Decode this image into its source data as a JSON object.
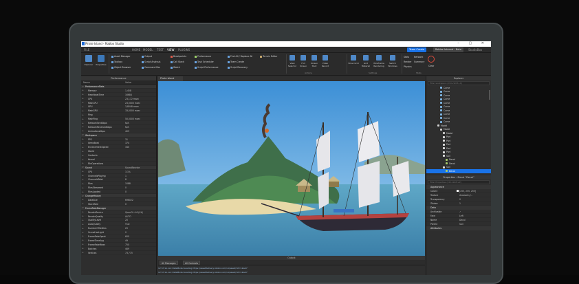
{
  "window": {
    "title": "Pirate Island - Roblox Studio"
  },
  "menu": {
    "tabs": [
      "FILE",
      "HOME",
      "MODEL",
      "TEST",
      "VIEW",
      "PLUGINS"
    ],
    "active_tab": "VIEW",
    "share_button": "Team Create",
    "beta_label": "Roblox Internal - Beta",
    "user": "StudioBox"
  },
  "ribbon": {
    "explorer": "Explorer",
    "properties": "Properties",
    "show_col1": [
      "Asset Manager",
      "Toolbox",
      "Object Browser"
    ],
    "show_col2": [
      "Output",
      "Script Analysis",
      "Command Bar"
    ],
    "show_col3": [
      "Breakpoints",
      "Call Stack",
      "Watch"
    ],
    "show_col4": [
      "Performance",
      "Task Scheduler",
      "Script Performance"
    ],
    "show_col5": [
      "Find All / Replace All",
      "Team Create",
      "Script Recovery"
    ],
    "show_col6": [
      "Terrain Editor"
    ],
    "actions_buttons": [
      "View Selector",
      "Full Screen",
      "Screen Shot",
      "Video Record"
    ],
    "settings_buttons": [
      "Show Grid",
      "Grid Material",
      "Wireframe Rendering",
      "Switch Windows"
    ],
    "stats": [
      "Stats",
      "Render",
      "Network",
      "Summary",
      "Physics"
    ],
    "clear_label": "Clear",
    "group_actions": "Actions",
    "group_settings": "Settings",
    "group_stats": "Stats"
  },
  "left_panel": {
    "title": "Performance",
    "col_name": "Name",
    "col_value": "Value",
    "rows": [
      {
        "name": "PerformanceStats",
        "value": "",
        "section": true
      },
      {
        "name": "Memory",
        "value": "1,458",
        "section": false
      },
      {
        "name": "HeartbeatTime",
        "value": "16684",
        "section": false
      },
      {
        "name": "CPU",
        "value": "23,172 msec",
        "section": false
      },
      {
        "name": "MainCPU",
        "value": "23,0000 msec",
        "section": false
      },
      {
        "name": "GPU",
        "value": "3,8048 msec",
        "section": false
      },
      {
        "name": "MainGPU",
        "value": "33,0000 msec",
        "section": false
      },
      {
        "name": "Ping",
        "value": "",
        "section": false
      },
      {
        "name": "MainPing",
        "value": "50,0000 msec",
        "section": false
      },
      {
        "name": "NetworkSentKbps",
        "value": "N/A",
        "section": false
      },
      {
        "name": "NetworkReceivedKbps",
        "value": "N/A",
        "section": false
      },
      {
        "name": "AnimationsKbps",
        "value": "409",
        "section": false
      },
      {
        "name": "Workspace",
        "value": "",
        "section": true
      },
      {
        "name": "FPS",
        "value": "31",
        "section": false
      },
      {
        "name": "ItemsBeat",
        "value": "374",
        "section": false
      },
      {
        "name": "EnvironmentSpeed",
        "value": "340",
        "section": false
      },
      {
        "name": "World",
        "value": "",
        "section": false
      },
      {
        "name": "Contacts",
        "value": "",
        "section": false
      },
      {
        "name": "Kernel",
        "value": "",
        "section": false
      },
      {
        "name": "FileOperations",
        "value": "",
        "section": false
      },
      {
        "name": "Sound",
        "value": "SoundService",
        "section": true
      },
      {
        "name": "CPU",
        "value": "3.1%",
        "section": false
      },
      {
        "name": "ChannelsPlaying",
        "value": "1",
        "section": false
      },
      {
        "name": "ChannelsTotal",
        "value": "8",
        "section": false
      },
      {
        "name": "Files",
        "value": "1088",
        "section": false
      },
      {
        "name": "FilesStreamed",
        "value": "0",
        "section": false
      },
      {
        "name": "FilesLoaded",
        "value": "0",
        "section": false
      },
      {
        "name": "ChangeHistory",
        "value": "",
        "section": true
      },
      {
        "name": "DataSize",
        "value": "696022",
        "section": false
      },
      {
        "name": "StackSize",
        "value": "0",
        "section": false
      },
      {
        "name": "FrameRateManager",
        "value": "",
        "section": true
      },
      {
        "name": "RenderDevice",
        "value": "OpenGL 4.6 (4X)",
        "section": false
      },
      {
        "name": "RenderQuality",
        "value": "AUTO",
        "section": false
      },
      {
        "name": "QualityLevel",
        "value": "20",
        "section": false
      },
      {
        "name": "AutoQuality",
        "value": "True",
        "section": false
      },
      {
        "name": "NumberOfSettles",
        "value": "25",
        "section": false
      },
      {
        "name": "SceneHasLight",
        "value": "0",
        "section": false
      },
      {
        "name": "FrameRateSpent",
        "value": "600",
        "section": false
      },
      {
        "name": "FrameTimeAvg",
        "value": "49",
        "section": false
      },
      {
        "name": "FrameRateMean",
        "value": "750",
        "section": false
      },
      {
        "name": "Batches",
        "value": "469",
        "section": false
      },
      {
        "name": "Vertices",
        "value": "73,775",
        "section": false
      }
    ]
  },
  "viewport": {
    "tab_label": "Pirate Island"
  },
  "output": {
    "title": "Output",
    "filter_messages": "All Messages",
    "filter_contexts": "All Contexts",
    "lines": [
      "12:57:xx.xxx  DataModel Loading https://assetdelivery.roblox.com/v1/asset/?id=1kw47",
      "12:57:xx.xxx  DataModel Loading https://assetdelivery.roblox.com/v1/asset/?id=1kw47"
    ]
  },
  "explorer": {
    "title": "Explorer",
    "filter_placeholder": "Filter workspace (Ctrl+Shift+X)",
    "items": [
      {
        "label": "Curve",
        "indent": 5,
        "icon": "#7fb8e6",
        "selected": false
      },
      {
        "label": "Curve",
        "indent": 5,
        "icon": "#7fb8e6",
        "selected": false
      },
      {
        "label": "Curve",
        "indent": 5,
        "icon": "#7fb8e6",
        "selected": false
      },
      {
        "label": "Curve",
        "indent": 5,
        "icon": "#7fb8e6",
        "selected": false
      },
      {
        "label": "Curve",
        "indent": 5,
        "icon": "#7fb8e6",
        "selected": false
      },
      {
        "label": "Curve",
        "indent": 5,
        "icon": "#7fb8e6",
        "selected": false
      },
      {
        "label": "Curve",
        "indent": 5,
        "icon": "#7fb8e6",
        "selected": false
      },
      {
        "label": "Curve",
        "indent": 5,
        "icon": "#7fb8e6",
        "selected": false
      },
      {
        "label": "Curve",
        "indent": 5,
        "icon": "#7fb8e6",
        "selected": false
      },
      {
        "label": "Curve",
        "indent": 5,
        "icon": "#7fb8e6",
        "selected": false
      },
      {
        "label": "Model",
        "indent": 4,
        "icon": "#d0d0d0",
        "selected": false
      },
      {
        "label": "Model",
        "indent": 5,
        "icon": "#d0d0d0",
        "selected": false
      },
      {
        "label": "Model",
        "indent": 6,
        "icon": "#d0d0d0",
        "selected": false
      },
      {
        "label": "Part",
        "indent": 6,
        "icon": "#e0e0e0",
        "selected": false
      },
      {
        "label": "Part",
        "indent": 6,
        "icon": "#e0e0e0",
        "selected": false
      },
      {
        "label": "Part",
        "indent": 6,
        "icon": "#e0e0e0",
        "selected": false
      },
      {
        "label": "Part",
        "indent": 6,
        "icon": "#e0e0e0",
        "selected": false
      },
      {
        "label": "Part",
        "indent": 6,
        "icon": "#e0e0e0",
        "selected": false
      },
      {
        "label": "Sail",
        "indent": 6,
        "icon": "#e0e0e0",
        "selected": false
      },
      {
        "label": "Decal",
        "indent": 7,
        "icon": "#a6c96a",
        "selected": false
      },
      {
        "label": "Decal",
        "indent": 7,
        "icon": "#a6c96a",
        "selected": false
      },
      {
        "label": "Sail",
        "indent": 6,
        "icon": "#e0e0e0",
        "selected": false
      },
      {
        "label": "Decal",
        "indent": 7,
        "icon": "#a6c96a",
        "selected": true
      }
    ]
  },
  "properties": {
    "title": "Properties - Decal \"Decal\"",
    "filter_placeholder": "Filter Properties (Ctrl+Shift+P)",
    "appearance": "Appearance",
    "appearance_rows": [
      {
        "name": "Color3",
        "value": "[255, 255, 255]",
        "swatch": "#ffffff"
      },
      {
        "name": "Texture",
        "value": "rbxasset://...",
        "swatch": ""
      },
      {
        "name": "Transparency",
        "value": "0",
        "swatch": ""
      },
      {
        "name": "ZIndex",
        "value": "1",
        "swatch": ""
      }
    ],
    "data": "Data",
    "data_rows": [
      {
        "name": "Archivable",
        "value": "✓",
        "swatch": ""
      },
      {
        "name": "Face",
        "value": "Left",
        "swatch": ""
      },
      {
        "name": "Name",
        "value": "Decal",
        "swatch": ""
      },
      {
        "name": "Parent",
        "value": "Sail",
        "swatch": ""
      }
    ],
    "attributes": "Attributes"
  },
  "colors": {
    "accent": "#1a73e8",
    "panel": "#2e2e2e",
    "ribbon": "#2b2b2b",
    "stop": "#e04b3a"
  }
}
